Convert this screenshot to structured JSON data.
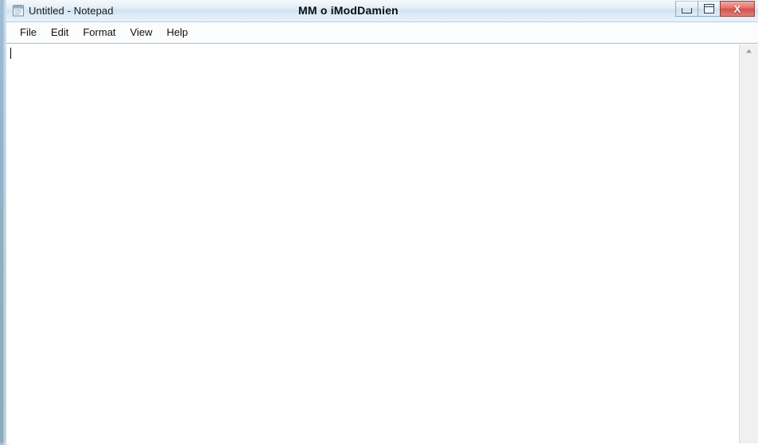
{
  "window": {
    "app_icon": "notepad-icon",
    "title_left": "Untitled - Notepad",
    "title_center": "MM o iModDamien",
    "controls": {
      "minimize_label": "Minimize",
      "maximize_label": "Maximize",
      "close_label": "Close",
      "close_glyph": "X",
      "close_color": "#d2524a"
    }
  },
  "menubar": {
    "items": [
      {
        "label": "File"
      },
      {
        "label": "Edit"
      },
      {
        "label": "Format"
      },
      {
        "label": "View"
      },
      {
        "label": "Help"
      }
    ]
  },
  "editor": {
    "content": "",
    "caret_visible": true
  },
  "scrollbar": {
    "up_arrow": "chevron-up-icon"
  },
  "colors": {
    "titlebar": "#d9e9f6",
    "menubar": "#fbfcfd",
    "editor_background": "#ffffff",
    "scrollbar_track": "#f0f0f0",
    "frame": "#98b4ce"
  }
}
